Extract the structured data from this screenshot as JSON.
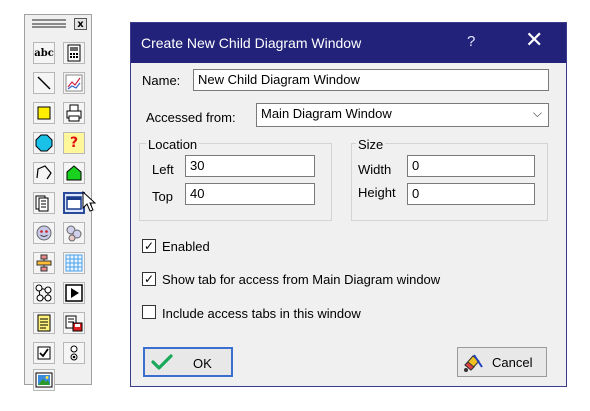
{
  "palette": {
    "close_label": "x",
    "tools": [
      {
        "name": "text-tool-icon",
        "glyph": "abc"
      },
      {
        "name": "calculator-tool-icon"
      },
      {
        "name": "line-tool-icon"
      },
      {
        "name": "graph-tool-icon"
      },
      {
        "name": "rectangle-tool-icon"
      },
      {
        "name": "printer-tool-icon"
      },
      {
        "name": "octagon-tool-icon"
      },
      {
        "name": "help-tool-icon",
        "glyph": "?"
      },
      {
        "name": "polygon-tool-icon"
      },
      {
        "name": "house-tool-icon"
      },
      {
        "name": "pages-tool-icon"
      },
      {
        "name": "child-window-tool-icon"
      },
      {
        "name": "face-tool-icon"
      },
      {
        "name": "faces-tool-icon"
      },
      {
        "name": "flowchart-tool-icon"
      },
      {
        "name": "grid-tool-icon"
      },
      {
        "name": "network-tool-icon"
      },
      {
        "name": "play-tool-icon"
      },
      {
        "name": "document-tool-icon"
      },
      {
        "name": "save-tool-icon"
      },
      {
        "name": "checkbox-tool-icon"
      },
      {
        "name": "radio-tool-icon"
      },
      {
        "name": "image-tool-icon"
      }
    ]
  },
  "dialog": {
    "title": "Create New Child Diagram Window",
    "help_label": "?",
    "close_label": "✕",
    "name_label": "Name:",
    "name_value": "New Child Diagram Window",
    "accessed_label": "Accessed from:",
    "accessed_value": "Main Diagram Window",
    "chevron": "⌵",
    "location": {
      "title": "Location",
      "left_label": "Left",
      "left_value": "30",
      "top_label": "Top",
      "top_value": "40"
    },
    "size": {
      "title": "Size",
      "width_label": "Width",
      "width_value": "0",
      "height_label": "Height",
      "height_value": "0"
    },
    "checkboxes": [
      {
        "label": "Enabled",
        "checked": true
      },
      {
        "label": "Show tab for access from Main Diagram window",
        "checked": true
      },
      {
        "label": "Include access tabs in this window",
        "checked": false
      }
    ],
    "check_mark": "✓",
    "ok_label": "OK",
    "cancel_label": "Cancel"
  }
}
